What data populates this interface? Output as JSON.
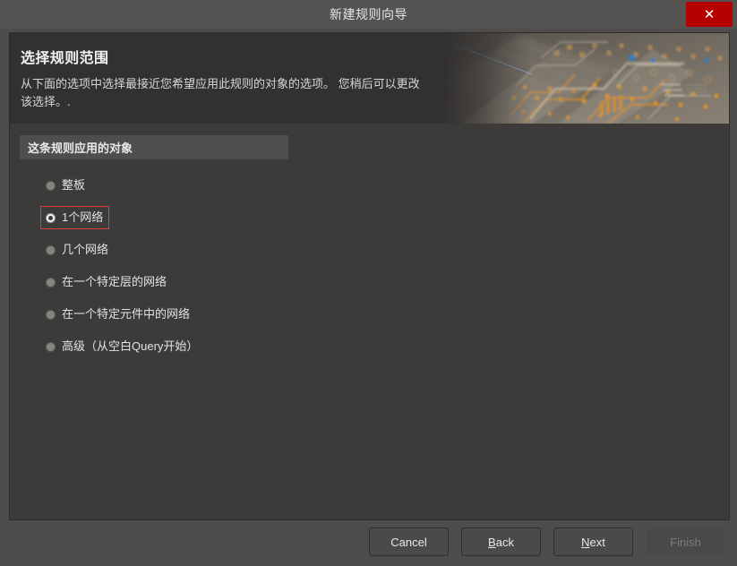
{
  "window": {
    "title": "新建规则向导",
    "close_icon": "close-icon",
    "close_glyph": "✕",
    "close_color": "#b60000"
  },
  "banner": {
    "heading": "选择规则范围",
    "description": "从下面的选项中选择最接近您希望应用此规则的对象的选项。 您稍后可以更改该选择。.",
    "art_name": "pcb-circuit-board-image"
  },
  "section": {
    "header": "这条规则应用的对象"
  },
  "options": [
    {
      "label": "整板",
      "checked": false,
      "highlighted": false
    },
    {
      "label": "1个网络",
      "checked": true,
      "highlighted": true
    },
    {
      "label": "几个网络",
      "checked": false,
      "highlighted": false
    },
    {
      "label": "在一个特定层的网络",
      "checked": false,
      "highlighted": false
    },
    {
      "label": "在一个特定元件中的网络",
      "checked": false,
      "highlighted": false
    },
    {
      "label": "高级（从空白Query开始）",
      "checked": false,
      "highlighted": false
    }
  ],
  "footer": {
    "buttons": [
      {
        "label": "Cancel",
        "accesskey": "",
        "disabled": false
      },
      {
        "label": "Back",
        "accesskey": "B",
        "disabled": false
      },
      {
        "label": "Next",
        "accesskey": "N",
        "disabled": false
      },
      {
        "label": "Finish",
        "accesskey": "",
        "disabled": true
      }
    ]
  },
  "colors": {
    "titlebar": "#555452",
    "content": "#3d3b39",
    "banner": "#333130",
    "section_header": "#4f4e4c",
    "footer": "#4e4d4b",
    "highlight": "#e03c3c",
    "close": "#b60000"
  }
}
